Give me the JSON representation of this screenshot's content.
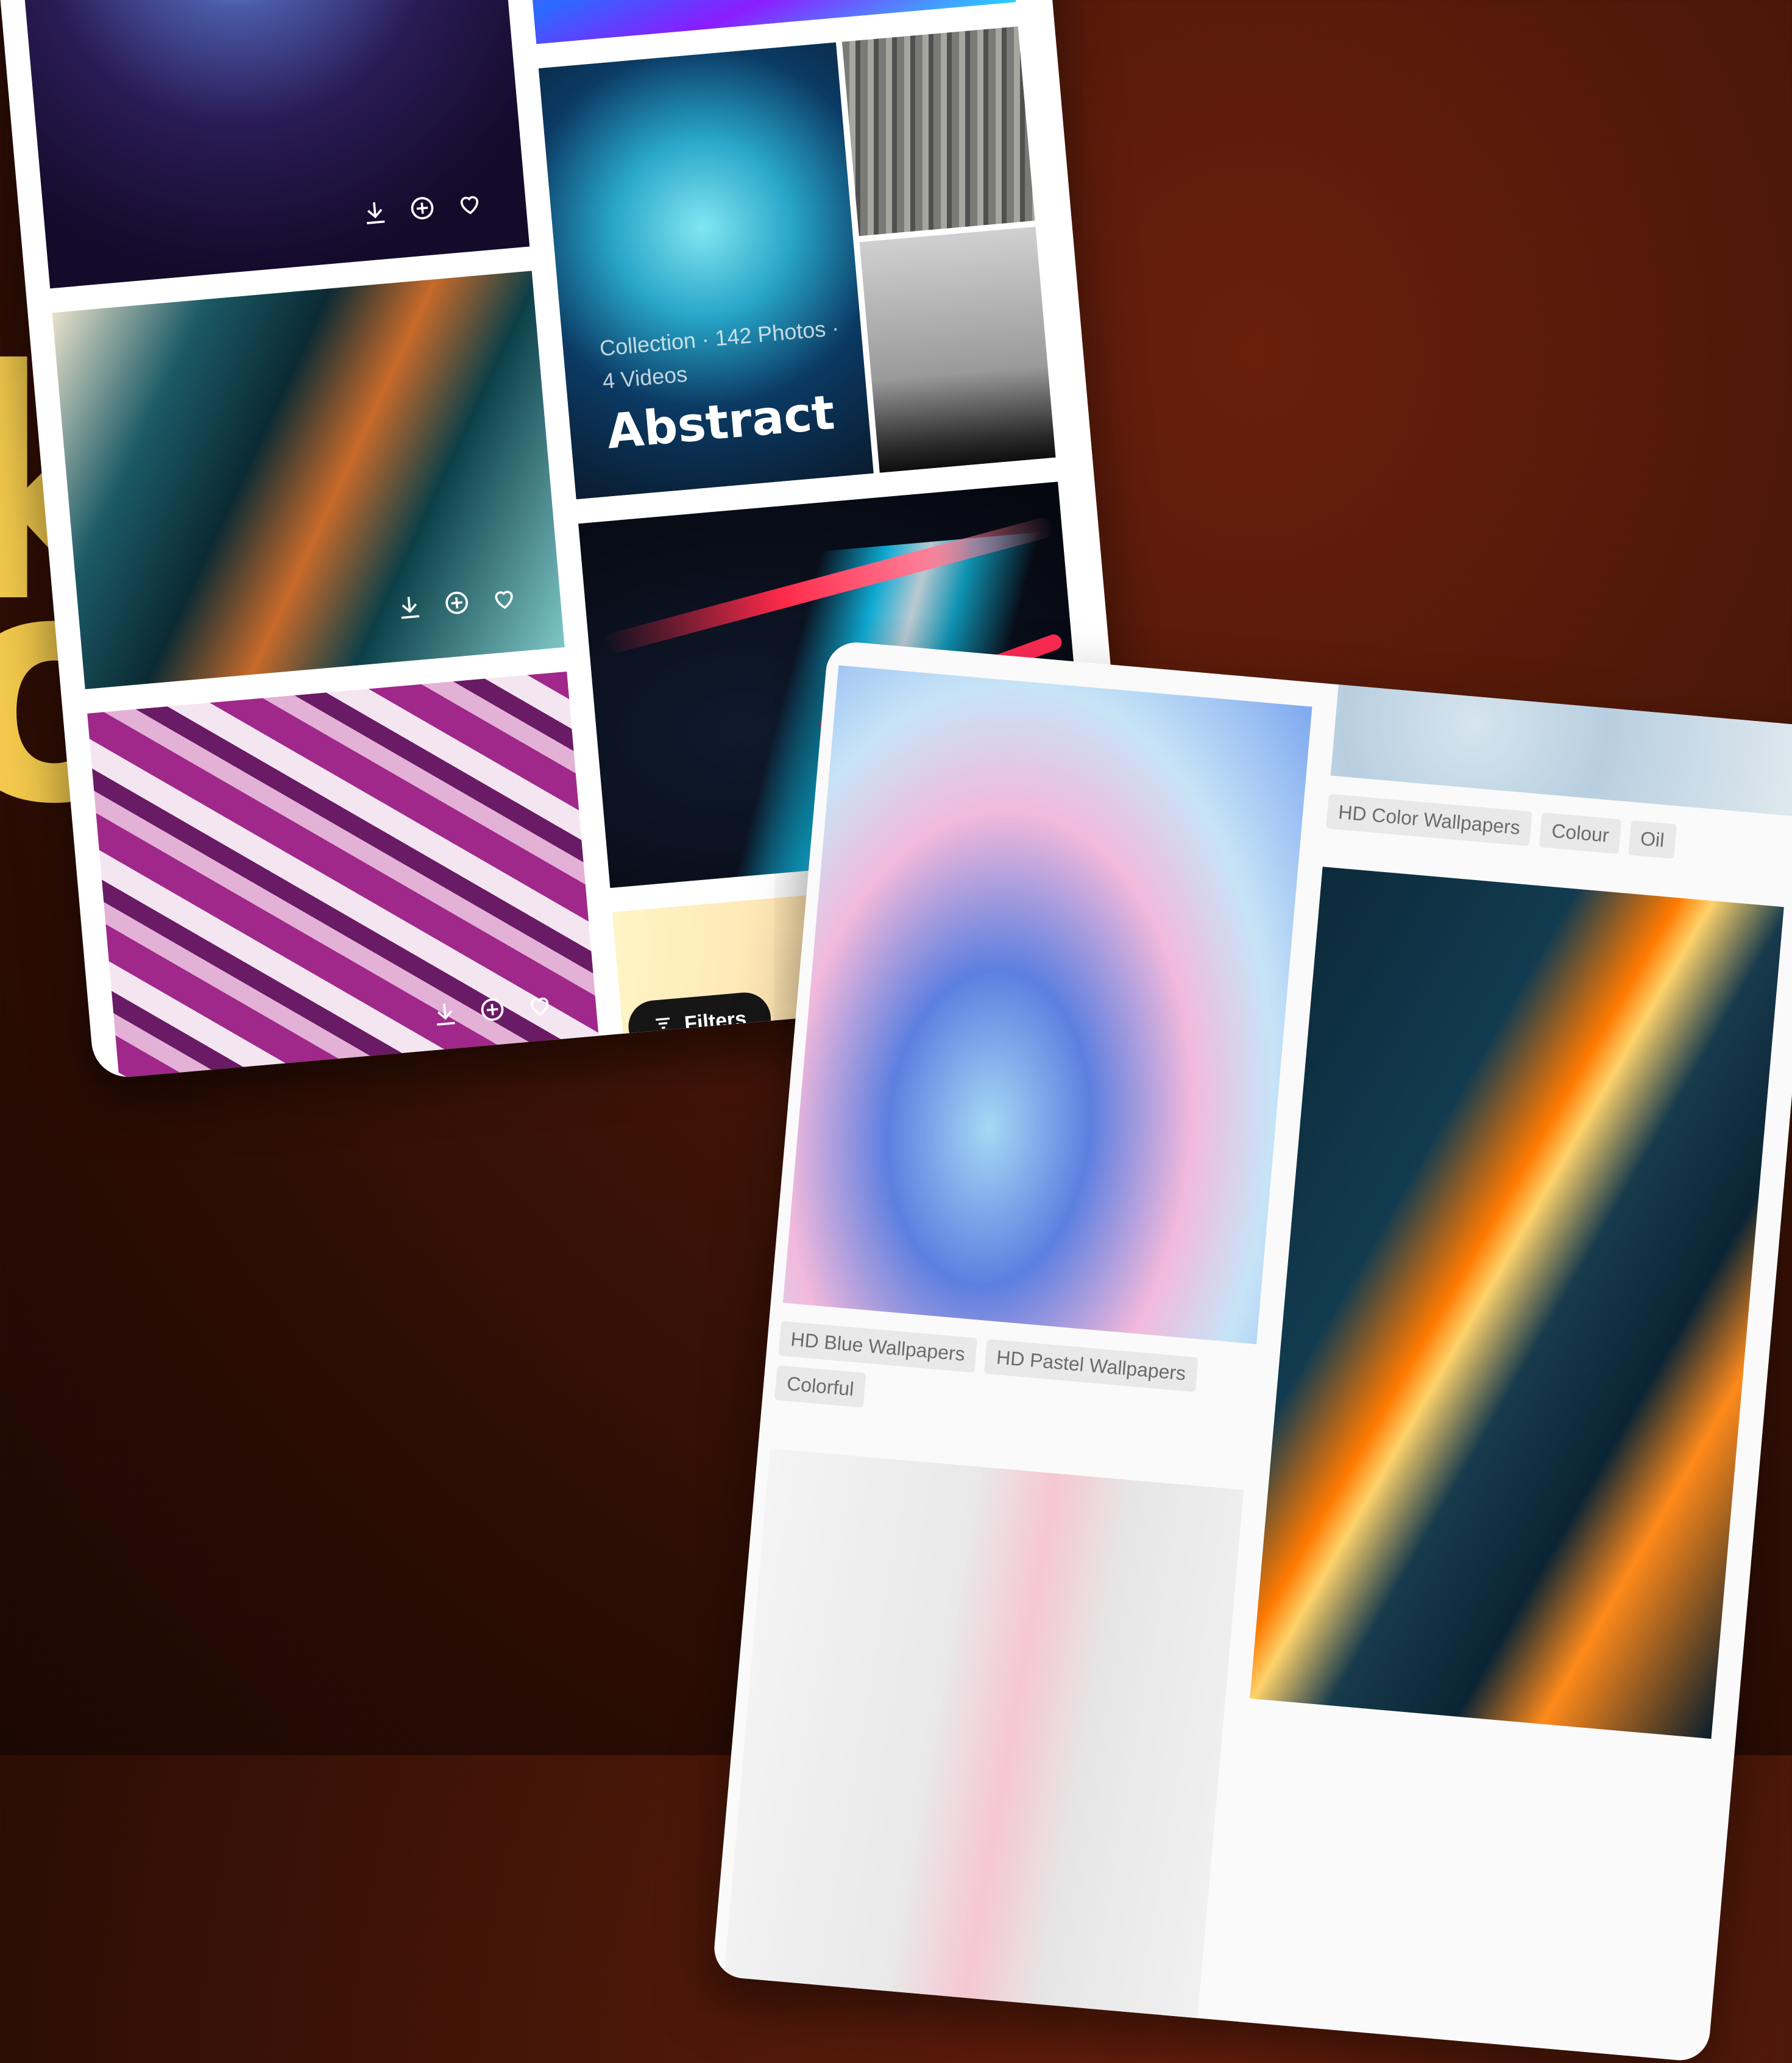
{
  "background": {
    "letters": [
      "ko",
      "o"
    ]
  },
  "panel_a": {
    "collection": {
      "meta": "Collection · 142 Photos · 4 Videos",
      "title": "Abstract"
    },
    "actions": {
      "download_icon": "download-icon",
      "add_icon": "add-circle-icon",
      "like_icon": "heart-icon"
    },
    "filters_label": "Filters"
  },
  "panel_b": {
    "tags_top": [
      "HD Color Wallpapers",
      "Colour",
      "Oil"
    ],
    "tags_left": [
      "HD Blue Wallpapers",
      "HD Pastel Wallpapers",
      "Colorful"
    ]
  },
  "colors": {
    "accent_yellow": "#f2c94c",
    "bg_brown": "#4a1708",
    "filter_button": "#161616"
  }
}
